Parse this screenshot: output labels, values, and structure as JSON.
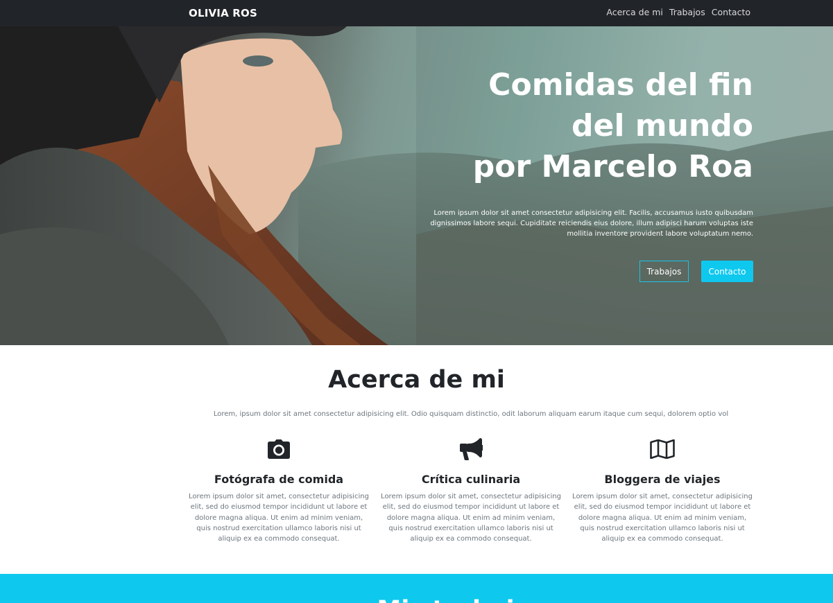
{
  "navbar": {
    "brand": "OLIVIA ROS",
    "links": [
      "Acerca de mi",
      "Trabajos",
      "Contacto"
    ]
  },
  "hero": {
    "title_lines": [
      "Comidas del fin",
      "del mundo",
      "por Marcelo Roa"
    ],
    "text": "Lorem ipsum dolor sit amet consectetur adipisicing elit. Facilis, accusamus iusto quibusdam dignissimos labore sequi. Cupiditate reiciendis eius dolore, illum adipisci harum voluptas iste mollitia inventore provident labore voluptatum nemo.",
    "buttons": {
      "secondary": "Trabajos",
      "primary": "Contacto"
    }
  },
  "about": {
    "title": "Acerca de mi",
    "lead": "Lorem, ipsum dolor sit amet consectetur adipisicing elit. Odio quisquam distinctio, odit laborum aliquam earum itaque cum sequi, dolorem optio vol",
    "features": [
      {
        "icon": "camera-icon",
        "title": "Fotógrafa de comida",
        "text": "Lorem ipsum dolor sit amet, consectetur adipisicing elit, sed do eiusmod tempor incididunt ut labore et dolore magna aliqua. Ut enim ad minim veniam, quis nostrud exercitation ullamco laboris nisi ut aliquip ex ea commodo consequat."
      },
      {
        "icon": "bullhorn-icon",
        "title": "Crítica culinaria",
        "text": "Lorem ipsum dolor sit amet, consectetur adipisicing elit, sed do eiusmod tempor incididunt ut labore et dolore magna aliqua. Ut enim ad minim veniam, quis nostrud exercitation ullamco laboris nisi ut aliquip ex ea commodo consequat."
      },
      {
        "icon": "map-icon",
        "title": "Bloggera de viajes",
        "text": "Lorem ipsum dolor sit amet, consectetur adipisicing elit, sed do eiusmod tempor incididunt ut labore et dolore magna aliqua. Ut enim ad minim veniam, quis nostrud exercitation ullamco laboris nisi ut aliquip ex ea commodo consequat."
      }
    ]
  },
  "portfolio": {
    "title": "Mis trabajos"
  },
  "colors": {
    "navbar": "#212428",
    "accent": "#0fc8ee",
    "text": "#212529",
    "muted": "#6c757d"
  }
}
